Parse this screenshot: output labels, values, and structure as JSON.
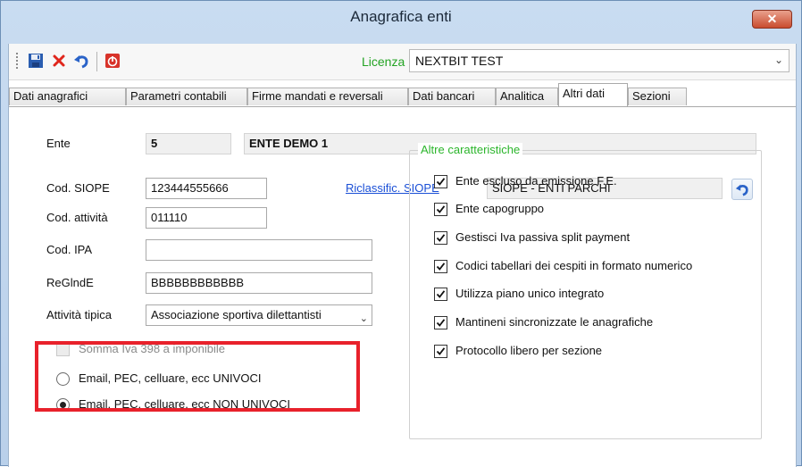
{
  "window": {
    "title": "Anagrafica enti",
    "close_glyph": "✕"
  },
  "toolbar": {
    "icons": [
      "save-icon",
      "delete-icon",
      "undo-icon",
      "power-icon"
    ],
    "licenza_label": "Licenza",
    "licenza_value": "NEXTBIT TEST",
    "dropdown_glyph": "⌄"
  },
  "tabs": [
    {
      "label": "Dati anagrafici"
    },
    {
      "label": "Parametri contabili"
    },
    {
      "label": "Firme mandati e reversali"
    },
    {
      "label": "Dati bancari"
    },
    {
      "label": "Analitica"
    },
    {
      "label": "Altri dati",
      "active": true
    },
    {
      "label": "Sezioni"
    }
  ],
  "form": {
    "ente_label": "Ente",
    "ente_code": "5",
    "ente_name": "ENTE DEMO 1",
    "cod_siope_label": "Cod. SIOPE",
    "cod_siope_value": "123444555666",
    "riclassific_link": "Riclassific. SIOPE",
    "siope_desc": "SIOPE - ENTI PARCHI",
    "cod_attivita_label": "Cod. attività",
    "cod_attivita_value": "011110",
    "cod_ipa_label": "Cod. IPA",
    "cod_ipa_value": "",
    "reglnde_label": "ReGlndE",
    "reglnde_value": "BBBBBBBBBBBB",
    "attivita_tipica_label": "Attività tipica",
    "attivita_tipica_value": "Associazione sportiva dilettantisti",
    "somma_iva_label": "Somma Iva 398 a imponibile",
    "radio_univoci": "Email, PEC, celluare, ecc  UNIVOCI",
    "radio_non_univoci": "Email, PEC, celluare, ecc  NON UNIVOCI",
    "selected_radio": "NON UNIVOCI"
  },
  "altre_caratteristiche": {
    "title": "Altre caratteristiche",
    "items": [
      {
        "label": "Ente escluso da emissione F.E.",
        "checked": true
      },
      {
        "label": "Ente capogruppo",
        "checked": true
      },
      {
        "label": "Gestisci Iva passiva split payment",
        "checked": true
      },
      {
        "label": "Codici tabellari dei cespiti in formato numerico",
        "checked": true
      },
      {
        "label": "Utilizza piano unico integrato",
        "checked": true
      },
      {
        "label": "Mantineni sincronizzate le anagrafiche",
        "checked": true
      },
      {
        "label": "Protocollo libero per sezione",
        "checked": true
      }
    ]
  },
  "colors": {
    "highlight": "#e8212b",
    "licenza": "#23a323",
    "group_title": "#2bb52b",
    "link": "#1a4fd6"
  }
}
